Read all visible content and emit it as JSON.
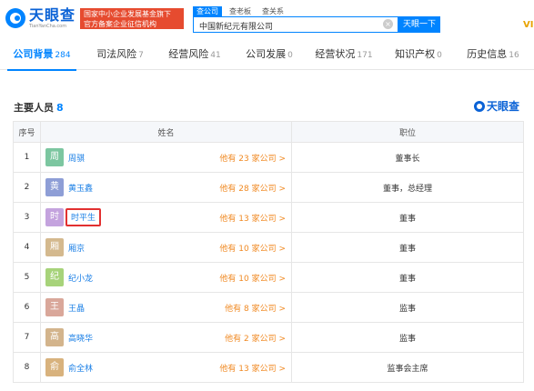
{
  "brand": {
    "name_cn": "天眼查",
    "name_en": "TianYanCha.com",
    "badge": "国家中小企业发展基金旗下 官方备案企业征信机构"
  },
  "search": {
    "tabs": [
      {
        "label": "查公司"
      },
      {
        "label": "查老板"
      },
      {
        "label": "查关系"
      }
    ],
    "query": "中国新纪元有限公司",
    "clear_glyph": "×",
    "button_label": "天眼一下",
    "vip_label": "VI"
  },
  "nav": [
    {
      "label": "公司背景",
      "count": "284"
    },
    {
      "label": "司法风险",
      "count": "7"
    },
    {
      "label": "经营风险",
      "count": "41"
    },
    {
      "label": "公司发展",
      "count": "0"
    },
    {
      "label": "经营状况",
      "count": "171"
    },
    {
      "label": "知识产权",
      "count": "0"
    },
    {
      "label": "历史信息",
      "count": "16"
    }
  ],
  "section": {
    "title": "主要人员",
    "count": "8",
    "brand": "天眼查"
  },
  "table": {
    "headers": {
      "index": "序号",
      "name": "姓名",
      "position": "职位"
    },
    "rows": [
      {
        "index": "1",
        "avatar": "周",
        "avatar_color": "#7cc6a0",
        "name": "周骐",
        "companies": "他有 23 家公司 >",
        "position": "董事长"
      },
      {
        "index": "2",
        "avatar": "黄",
        "avatar_color": "#8e9ed6",
        "name": "黄玉鑫",
        "companies": "他有 28 家公司 >",
        "position": "董事，总经理"
      },
      {
        "index": "3",
        "avatar": "时",
        "avatar_color": "#c4a3de",
        "name": "时平生",
        "companies": "他有 13 家公司 >",
        "position": "董事"
      },
      {
        "index": "4",
        "avatar": "厢",
        "avatar_color": "#d4b98e",
        "name": "厢京",
        "companies": "他有 10 家公司 >",
        "position": "董事"
      },
      {
        "index": "5",
        "avatar": "纪",
        "avatar_color": "#a7d37a",
        "name": "纪小龙",
        "companies": "他有 10 家公司 >",
        "position": "董事"
      },
      {
        "index": "6",
        "avatar": "王",
        "avatar_color": "#d9a79a",
        "name": "王晶",
        "companies": "他有 8 家公司 >",
        "position": "监事"
      },
      {
        "index": "7",
        "avatar": "高",
        "avatar_color": "#d3b48c",
        "name": "高晓华",
        "companies": "他有 2 家公司 >",
        "position": "监事"
      },
      {
        "index": "8",
        "avatar": "俞",
        "avatar_color": "#d8b27d",
        "name": "俞全林",
        "companies": "他有 13 家公司 >",
        "position": "监事会主席"
      }
    ]
  }
}
